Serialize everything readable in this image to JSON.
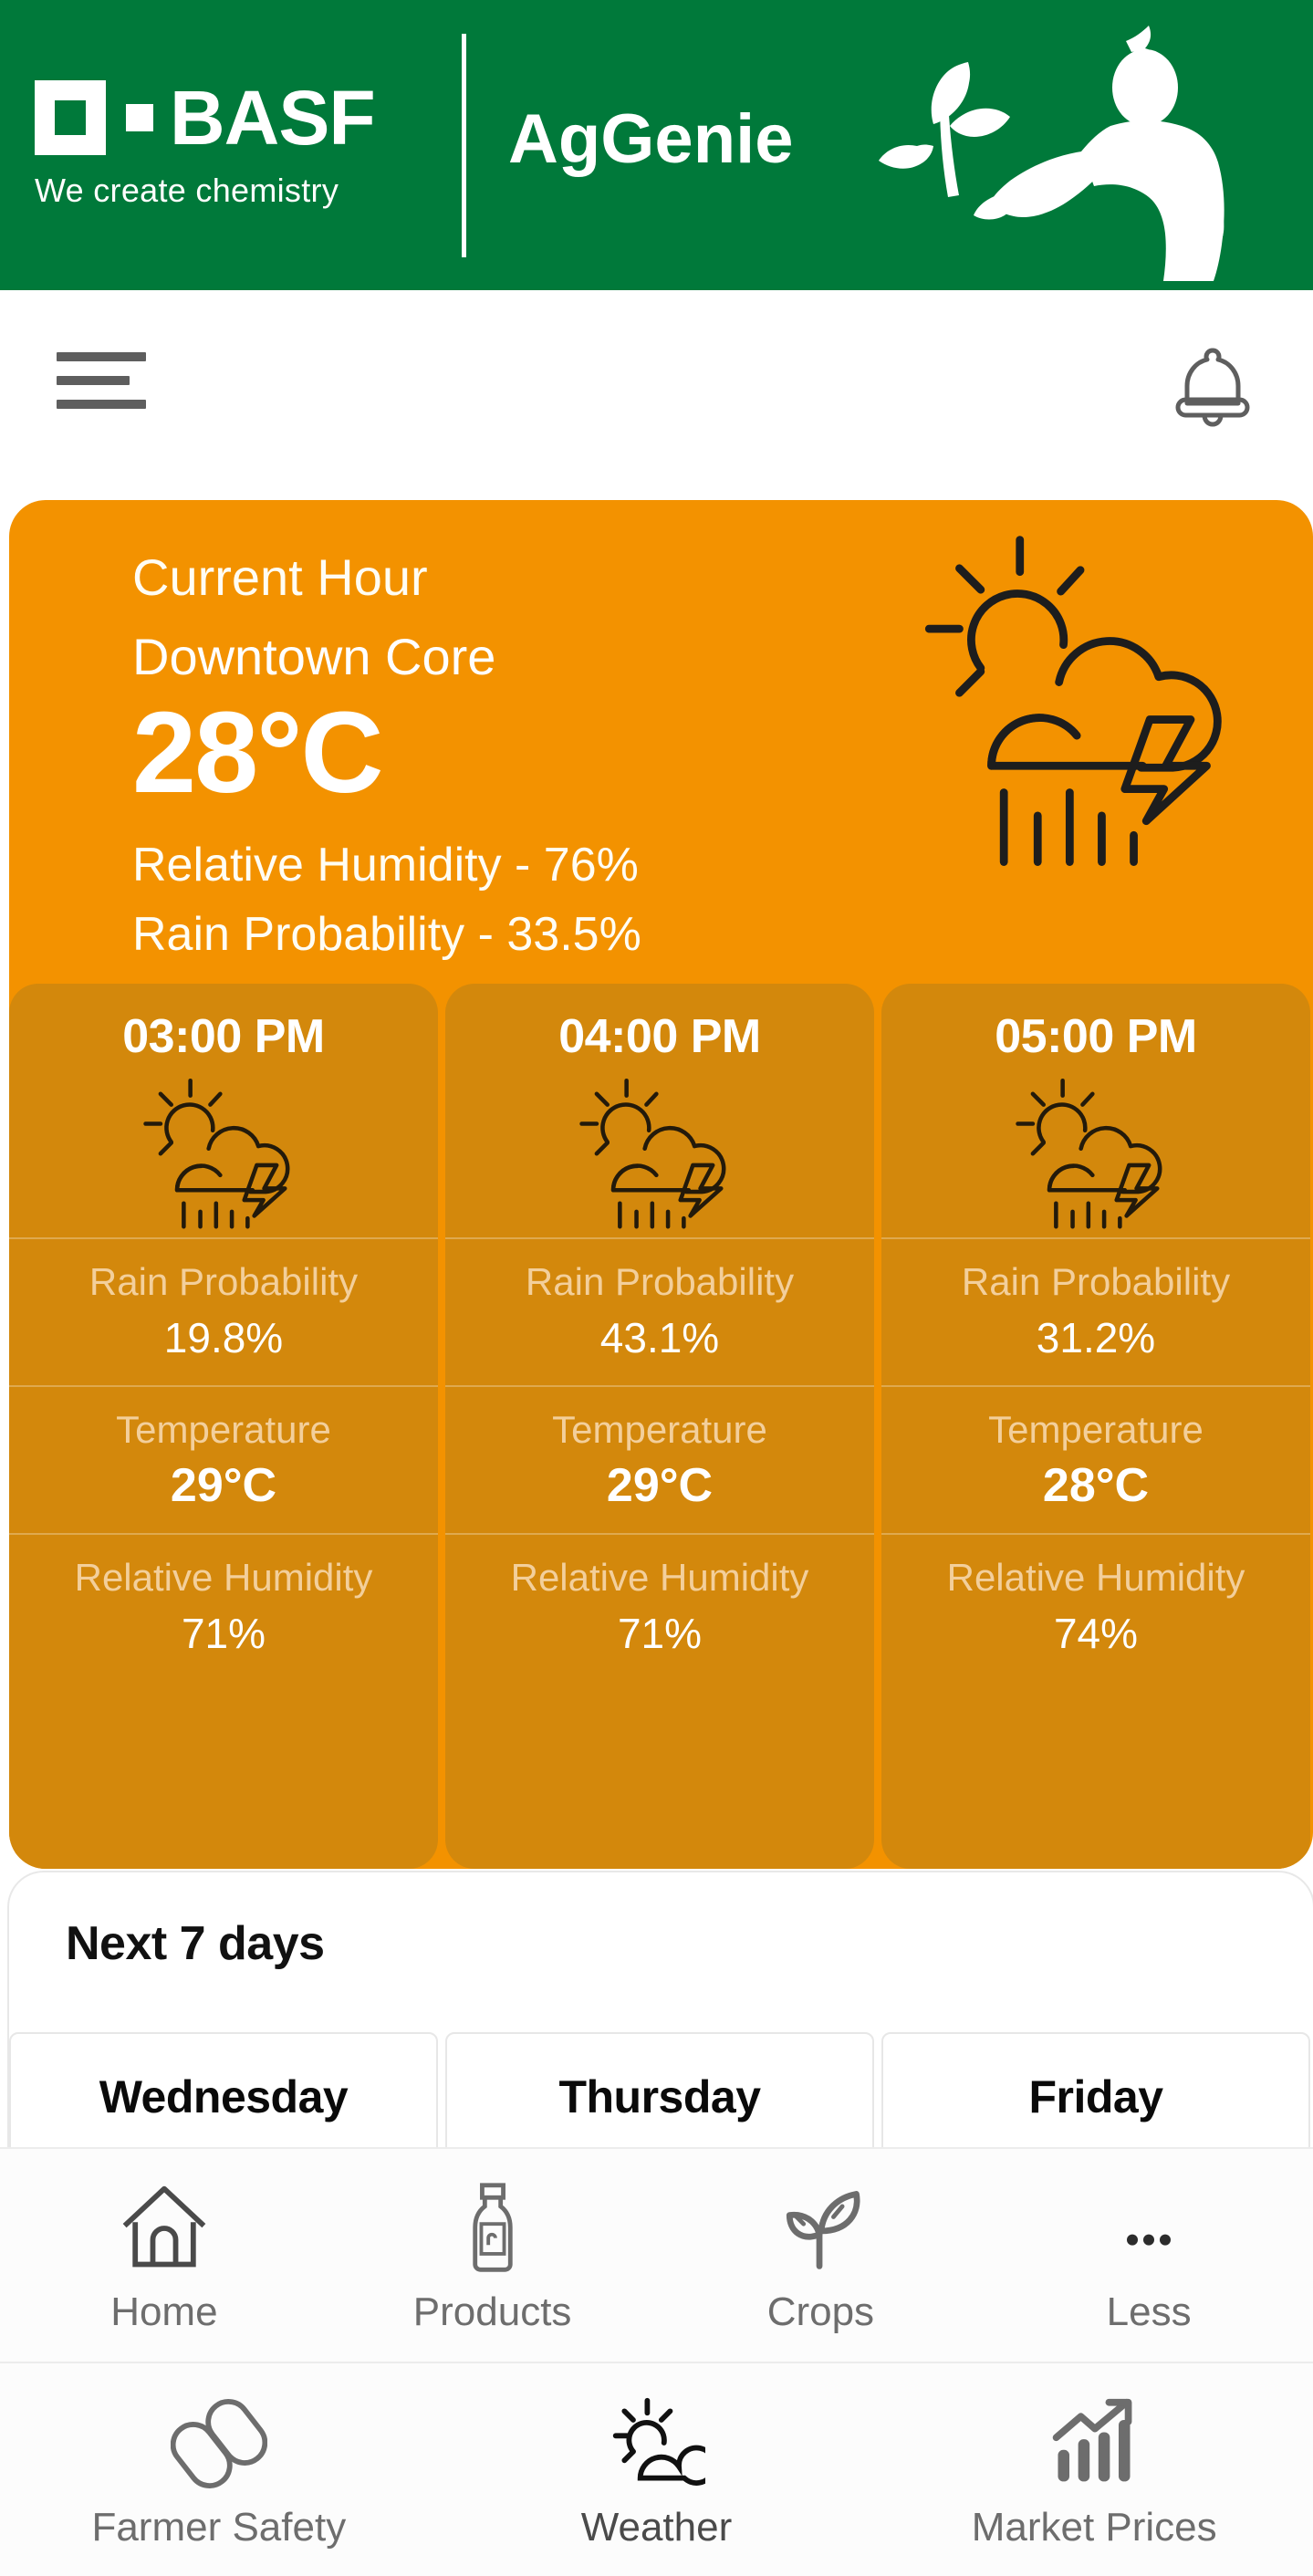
{
  "brand": {
    "company": "BASF",
    "tagline": "We create chemistry",
    "app_name": "AgGenie",
    "header_color": "#00793a",
    "logo_icon": "basf-square-logo",
    "app_logo_icon": "genie-holding-plant-icon"
  },
  "top_bar": {
    "menu_icon": "hamburger-menu-icon",
    "notification_icon": "bell-icon"
  },
  "current": {
    "label": "Current Hour",
    "location": "Downtown Core",
    "temperature": "28°C",
    "humidity": "Relative Humidity - 76%",
    "rain": "Rain Probability - 33.5%",
    "icon": "sun-cloud-rain-lightning-icon",
    "card_color": "#f39200"
  },
  "hourly": {
    "card_color": "#d3880c",
    "labels": {
      "rain": "Rain Probability",
      "temperature": "Temperature",
      "humidity": "Relative Humidity"
    },
    "items": [
      {
        "time": "03:00 PM",
        "icon": "sun-cloud-rain-lightning-icon",
        "rain": "19.8%",
        "temperature": "29°C",
        "humidity": "71%"
      },
      {
        "time": "04:00 PM",
        "icon": "sun-cloud-rain-lightning-icon",
        "rain": "43.1%",
        "temperature": "29°C",
        "humidity": "71%"
      },
      {
        "time": "05:00 PM",
        "icon": "sun-cloud-rain-lightning-icon",
        "rain": "31.2%",
        "temperature": "28°C",
        "humidity": "74%"
      }
    ]
  },
  "next7": {
    "title": "Next 7 days",
    "days": [
      {
        "name": "Wednesday",
        "icon": "sun-icon"
      },
      {
        "name": "Thursday",
        "icon": "thermometer-icon"
      },
      {
        "name": "Friday",
        "icon": "cloud-icon"
      }
    ]
  },
  "bottom_nav": {
    "row1": [
      {
        "label": "Home",
        "icon": "house-icon"
      },
      {
        "label": "Products",
        "icon": "bottle-icon"
      },
      {
        "label": "Crops",
        "icon": "seedling-icon"
      },
      {
        "label": "Less",
        "icon": "three-dots-icon"
      }
    ],
    "row2": [
      {
        "label": "Farmer Safety",
        "icon": "chain-links-icon"
      },
      {
        "label": "Weather",
        "icon": "sun-cloud-icon",
        "active": true
      },
      {
        "label": "Market Prices",
        "icon": "bar-chart-arrow-icon"
      }
    ]
  }
}
